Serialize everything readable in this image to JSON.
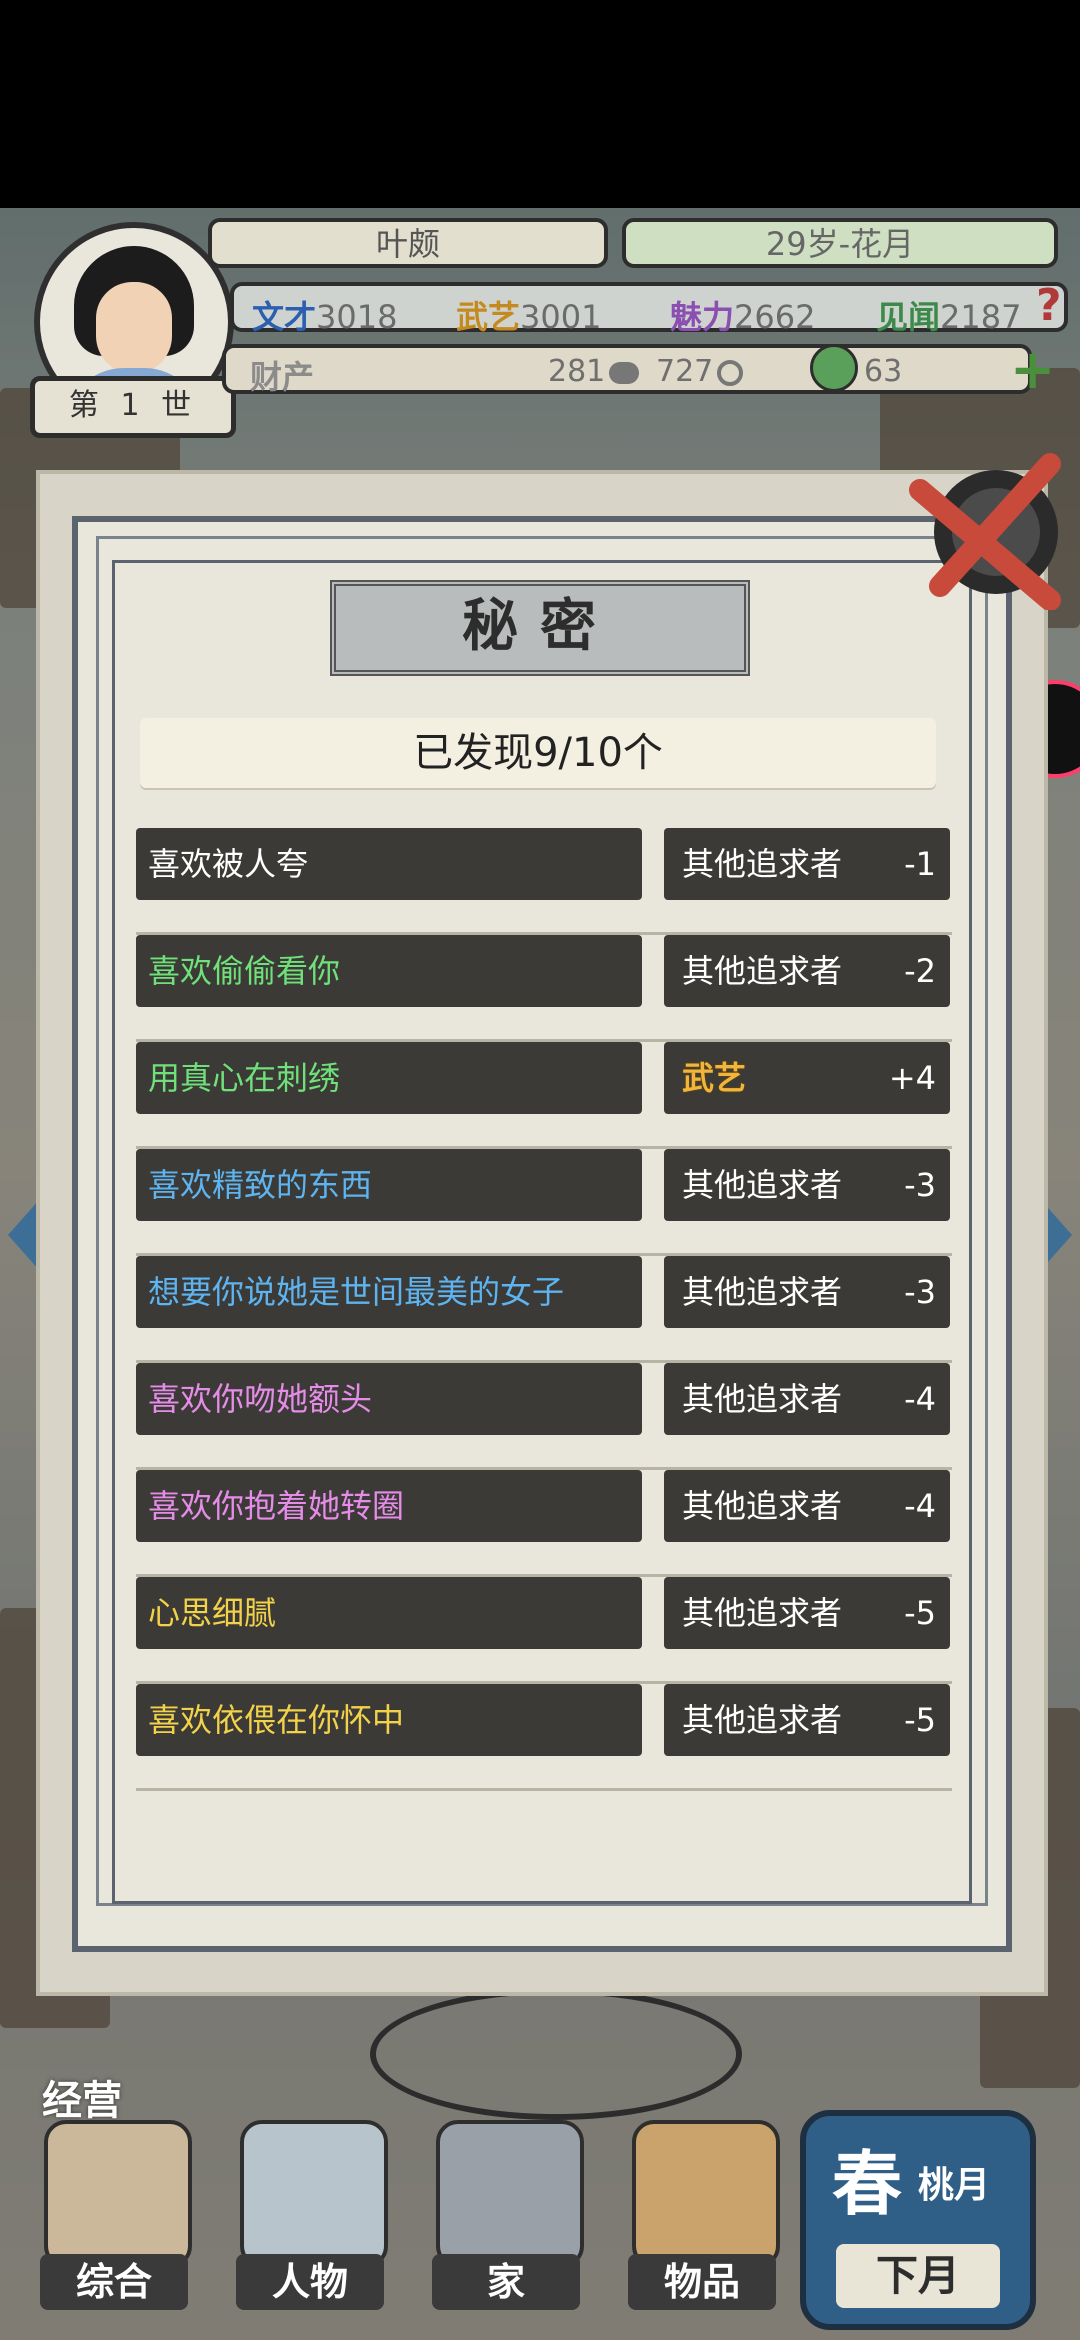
{
  "hud": {
    "name": "叶颇",
    "age_season": "29岁-花月",
    "generation": "第 1 世",
    "stats": [
      {
        "label": "文才",
        "value": "3018",
        "color": "#2d5fb0"
      },
      {
        "label": "武艺",
        "value": "3001",
        "color": "#c58a1f"
      },
      {
        "label": "魅力",
        "value": "2662",
        "color": "#8a4fb0"
      },
      {
        "label": "见闻",
        "value": "2187",
        "color": "#3b8a4a"
      }
    ],
    "assets_label": "财产",
    "silver": "281",
    "copper": "727",
    "jade": "63",
    "help": "?"
  },
  "dialog": {
    "title": "秘密",
    "discovered": "已发现9/10个",
    "secrets": [
      {
        "desc": "喜欢被人夸",
        "color": "#ffffff",
        "target": "其他追求者",
        "value": "-1",
        "martial": false
      },
      {
        "desc": "喜欢偷偷看你",
        "color": "#6fe07a",
        "target": "其他追求者",
        "value": "-2",
        "martial": false
      },
      {
        "desc": "用真心在刺绣",
        "color": "#6fe07a",
        "target": "武艺",
        "value": "+4",
        "martial": true
      },
      {
        "desc": "喜欢精致的东西",
        "color": "#5db4f0",
        "target": "其他追求者",
        "value": "-3",
        "martial": false
      },
      {
        "desc": "想要你说她是世间最美的女子",
        "color": "#5db4f0",
        "target": "其他追求者",
        "value": "-3",
        "martial": false
      },
      {
        "desc": "喜欢你吻她额头",
        "color": "#e58ce8",
        "target": "其他追求者",
        "value": "-4",
        "martial": false
      },
      {
        "desc": "喜欢你抱着她转圈",
        "color": "#e58ce8",
        "target": "其他追求者",
        "value": "-4",
        "martial": false
      },
      {
        "desc": "心思细腻",
        "color": "#f2d24a",
        "target": "其他追求者",
        "value": "-5",
        "martial": false
      },
      {
        "desc": "喜欢依偎在你怀中",
        "color": "#f2d24a",
        "target": "其他追求者",
        "value": "-5",
        "martial": false
      }
    ]
  },
  "nav": {
    "manage": "经营",
    "items": [
      {
        "label": "综合",
        "icon": "scroll-icon"
      },
      {
        "label": "人物",
        "icon": "person-icon"
      },
      {
        "label": "家",
        "icon": "house-icon"
      },
      {
        "label": "物品",
        "icon": "items-icon"
      }
    ],
    "season": "春",
    "month": "桃月",
    "next_month": "下月"
  }
}
